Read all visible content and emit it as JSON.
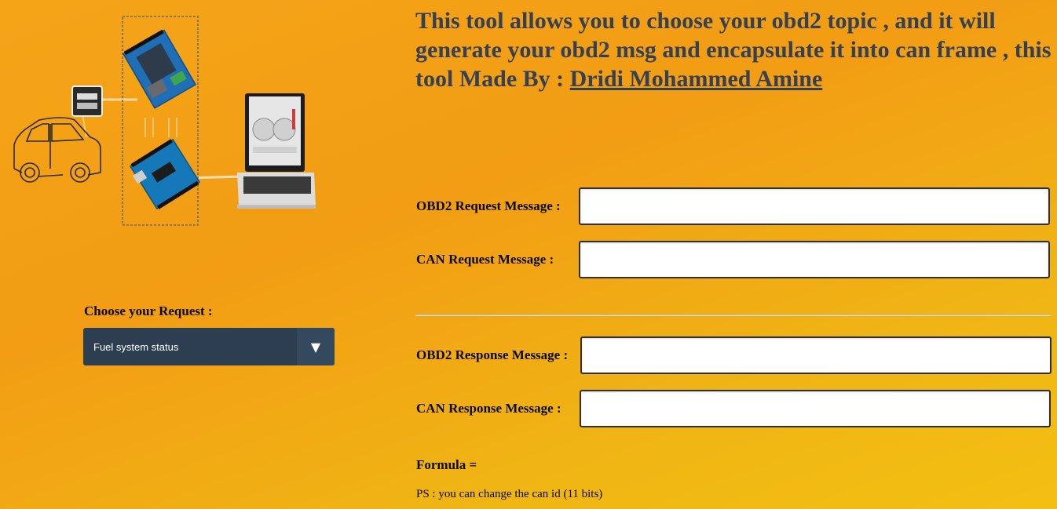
{
  "header": {
    "intro_text": "This tool allows you to choose your obd2 topic , and it will generate your obd2 msg and encapsulate it into can frame , this tool Made By : ",
    "author_link": "Dridi Mohammed Amine"
  },
  "illustration": {
    "icons": [
      "car-outline-icon",
      "obd2-connector-icon",
      "arduino-can-shield-icon",
      "arduino-uno-icon",
      "laptop-dashboard-icon"
    ]
  },
  "request": {
    "label": "Choose your Request :",
    "selected": "Fuel system status",
    "arrow_glyph": "▼"
  },
  "fields": {
    "obd2_request_label": "OBD2 Request Message :",
    "obd2_request_value": "",
    "can_request_label": "CAN Request Message :",
    "can_request_value": "",
    "obd2_response_label": "OBD2 Response Message :",
    "obd2_response_value": "",
    "can_response_label": "CAN Response Message :",
    "can_response_value": ""
  },
  "formula_label": "Formula =",
  "ps_note": "PS : you can change the can id (11 bits)",
  "colors": {
    "background_start": "#f5a418",
    "background_end": "#f3c012",
    "title_text": "#354052",
    "select_bg": "#2c3e50",
    "select_arrow_bg": "#34495e"
  }
}
